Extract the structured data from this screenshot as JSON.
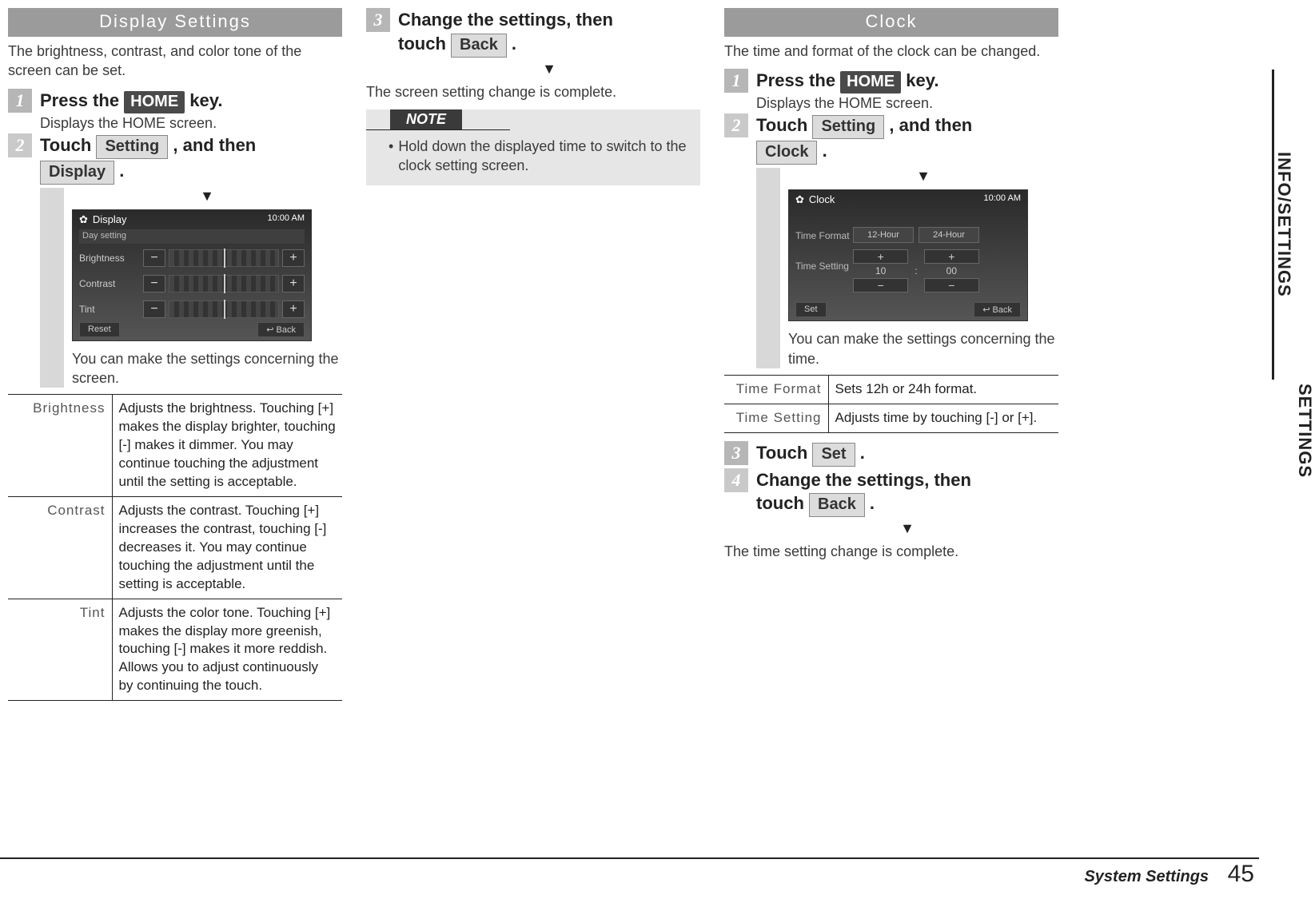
{
  "footer": {
    "section": "System Settings",
    "page": "45"
  },
  "side_tabs": {
    "top": "INFO/SETTINGS",
    "bottom": "SETTINGS"
  },
  "display": {
    "title": "Display Settings",
    "intro": "The brightness, contrast, and color tone of the screen can be set.",
    "step1": {
      "num": "1",
      "pre": "Press the ",
      "btn": "HOME",
      "post": " key.",
      "sub": "Displays the HOME screen."
    },
    "step2": {
      "num": "2",
      "pre": "Touch ",
      "btn1": "Setting",
      "mid": " , and then ",
      "btn2": "Display",
      "post": " ."
    },
    "ss": {
      "title": "Display",
      "time": "10:00 AM",
      "sub": "Day setting",
      "rows": [
        "Brightness",
        "Contrast",
        "Tint"
      ],
      "reset": "Reset",
      "back": "Back"
    },
    "after_ss": "You can make the settings concerning the screen.",
    "table": [
      {
        "term": "Brightness",
        "desc": "Adjusts the brightness. Touching [+] makes the display brighter, touching [-] makes it dimmer. You may continue touching the adjustment until the setting is acceptable."
      },
      {
        "term": "Contrast",
        "desc": "Adjusts the contrast. Touching [+] increases the contrast, touching [-] decreases it. You may continue touching the adjustment until the setting is acceptable."
      },
      {
        "term": "Tint",
        "desc": "Adjusts the color tone. Touching [+] makes the display more greenish, touching [-] makes it more reddish. Allows you to adjust continuously by continuing the touch."
      }
    ]
  },
  "mid": {
    "step3": {
      "num": "3",
      "line1_pre": "Change the settings, then",
      "line2_pre": "touch ",
      "btn": "Back",
      "line2_post": " ."
    },
    "result": "The screen setting change is complete.",
    "note_label": "NOTE",
    "note_text": "Hold down the displayed time to switch to the clock setting screen."
  },
  "clock": {
    "title": "Clock",
    "intro": "The time and format of the clock can be changed.",
    "step1": {
      "num": "1",
      "pre": "Press the ",
      "btn": "HOME",
      "post": " key.",
      "sub": "Displays the HOME screen."
    },
    "step2": {
      "num": "2",
      "pre": "Touch ",
      "btn1": "Setting",
      "mid": " , and then ",
      "btn2": "Clock",
      "post": " ."
    },
    "ss": {
      "title": "Clock",
      "time": "10:00 AM",
      "tf_label": "Time Format",
      "tf_opts": [
        "12-Hour",
        "24-Hour"
      ],
      "ts_label": "Time Setting",
      "hh": "10",
      "mm": "00",
      "set": "Set",
      "back": "Back"
    },
    "after_ss": "You can make the settings concerning the time.",
    "table": [
      {
        "term": "Time Format",
        "desc": "Sets 12h or 24h format."
      },
      {
        "term": "Time Setting",
        "desc": "Adjusts time by touching [-] or [+]."
      }
    ],
    "step3": {
      "num": "3",
      "pre": "Touch ",
      "btn": "Set",
      "post": " ."
    },
    "step4": {
      "num": "4",
      "line1_pre": "Change the settings, then",
      "line2_pre": "touch ",
      "btn": "Back",
      "line2_post": " ."
    },
    "result": "The time setting change is complete."
  },
  "glyph": {
    "arrow": "▼",
    "bullet": "•",
    "back_arrow": "↩",
    "gear": "✿"
  }
}
